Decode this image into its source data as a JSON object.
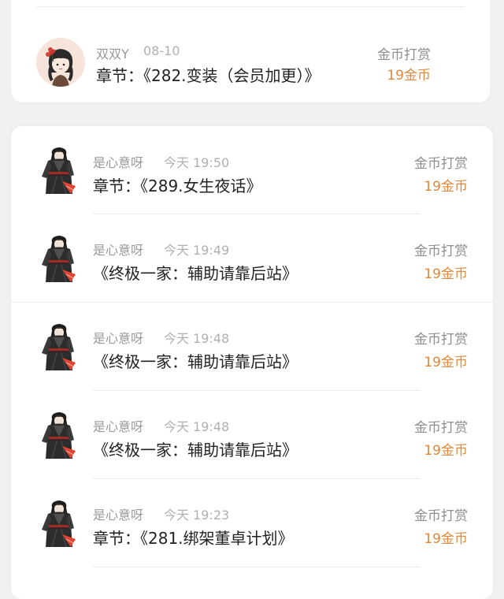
{
  "top_item": {
    "username": "双双Y",
    "time": "08-10",
    "content": "章节：《282.变装（会员加更）》",
    "gift_label": "金币打赏",
    "gift_amount": "19金币",
    "avatar": "avatar-girl-red-flower-icon"
  },
  "items": [
    {
      "username": "是心意呀",
      "time": "今天 19:50",
      "content": "章节：《289.女生夜话》",
      "gift_label": "金币打赏",
      "gift_amount": "19金币",
      "avatar": "avatar-swordsman-icon"
    },
    {
      "username": "是心意呀",
      "time": "今天 19:49",
      "content": "《终极一家：辅助请靠后站》",
      "gift_label": "金币打赏",
      "gift_amount": "19金币",
      "avatar": "avatar-swordsman-icon"
    },
    {
      "username": "是心意呀",
      "time": "今天 19:48",
      "content": "《终极一家：辅助请靠后站》",
      "gift_label": "金币打赏",
      "gift_amount": "19金币",
      "avatar": "avatar-swordsman-icon"
    },
    {
      "username": "是心意呀",
      "time": "今天 19:48",
      "content": "《终极一家：辅助请靠后站》",
      "gift_label": "金币打赏",
      "gift_amount": "19金币",
      "avatar": "avatar-swordsman-icon"
    },
    {
      "username": "是心意呀",
      "time": "今天 19:23",
      "content": "章节：《281.绑架董卓计划》",
      "gift_label": "金币打赏",
      "gift_amount": "19金币",
      "avatar": "avatar-swordsman-icon"
    }
  ],
  "colors": {
    "accent_gold": "#e2883c",
    "text_primary": "#222222",
    "text_secondary": "#999999",
    "background": "#f1f1f1"
  }
}
